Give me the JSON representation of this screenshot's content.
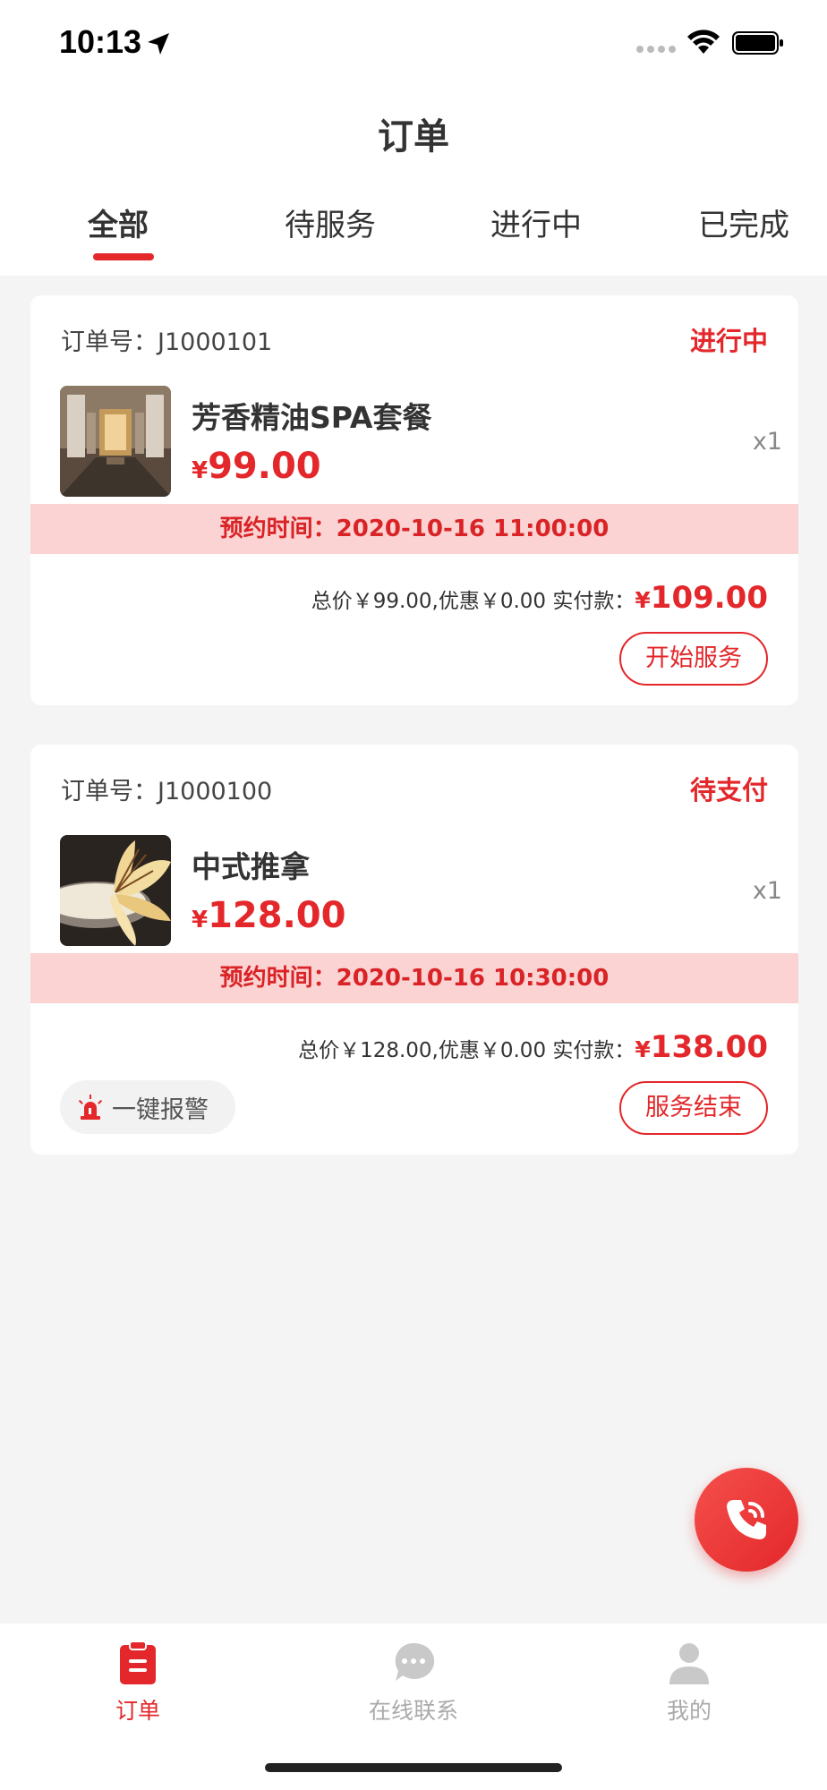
{
  "status_bar": {
    "time": "10:13"
  },
  "header": {
    "title": "订单"
  },
  "tabs": [
    {
      "label": "全部",
      "active": true
    },
    {
      "label": "待服务",
      "active": false
    },
    {
      "label": "进行中",
      "active": false
    },
    {
      "label": "已完成",
      "active": false
    }
  ],
  "orders": [
    {
      "order_no": "订单号：J1000101",
      "status": "进行中",
      "product_name": "芳香精油SPA套餐",
      "currency": "¥",
      "price": "99.00",
      "qty": "x1",
      "appointment": "预约时间：2020-10-16 11:00:00",
      "summary_text": "总价￥99.00,优惠￥0.00 实付款：",
      "paid": "109.00",
      "action_label": "开始服务"
    },
    {
      "order_no": "订单号：J1000100",
      "status": "待支付",
      "product_name": "中式推拿",
      "currency": "¥",
      "price": "128.00",
      "qty": "x1",
      "appointment": "预约时间：2020-10-16 10:30:00",
      "summary_text": "总价￥128.00,优惠￥0.00 实付款：",
      "paid": "138.00",
      "alarm_label": "一键报警",
      "action_label": "服务结束"
    }
  ],
  "bottom_nav": [
    {
      "label": "订单",
      "icon": "clipboard-icon",
      "active": true
    },
    {
      "label": "在线联系",
      "icon": "chat-bubble-icon",
      "active": false
    },
    {
      "label": "我的",
      "icon": "person-icon",
      "active": false
    }
  ],
  "colors": {
    "accent": "#e3272a",
    "appointment_bg": "#fbd3d3",
    "page_bg": "#f4f4f4"
  }
}
